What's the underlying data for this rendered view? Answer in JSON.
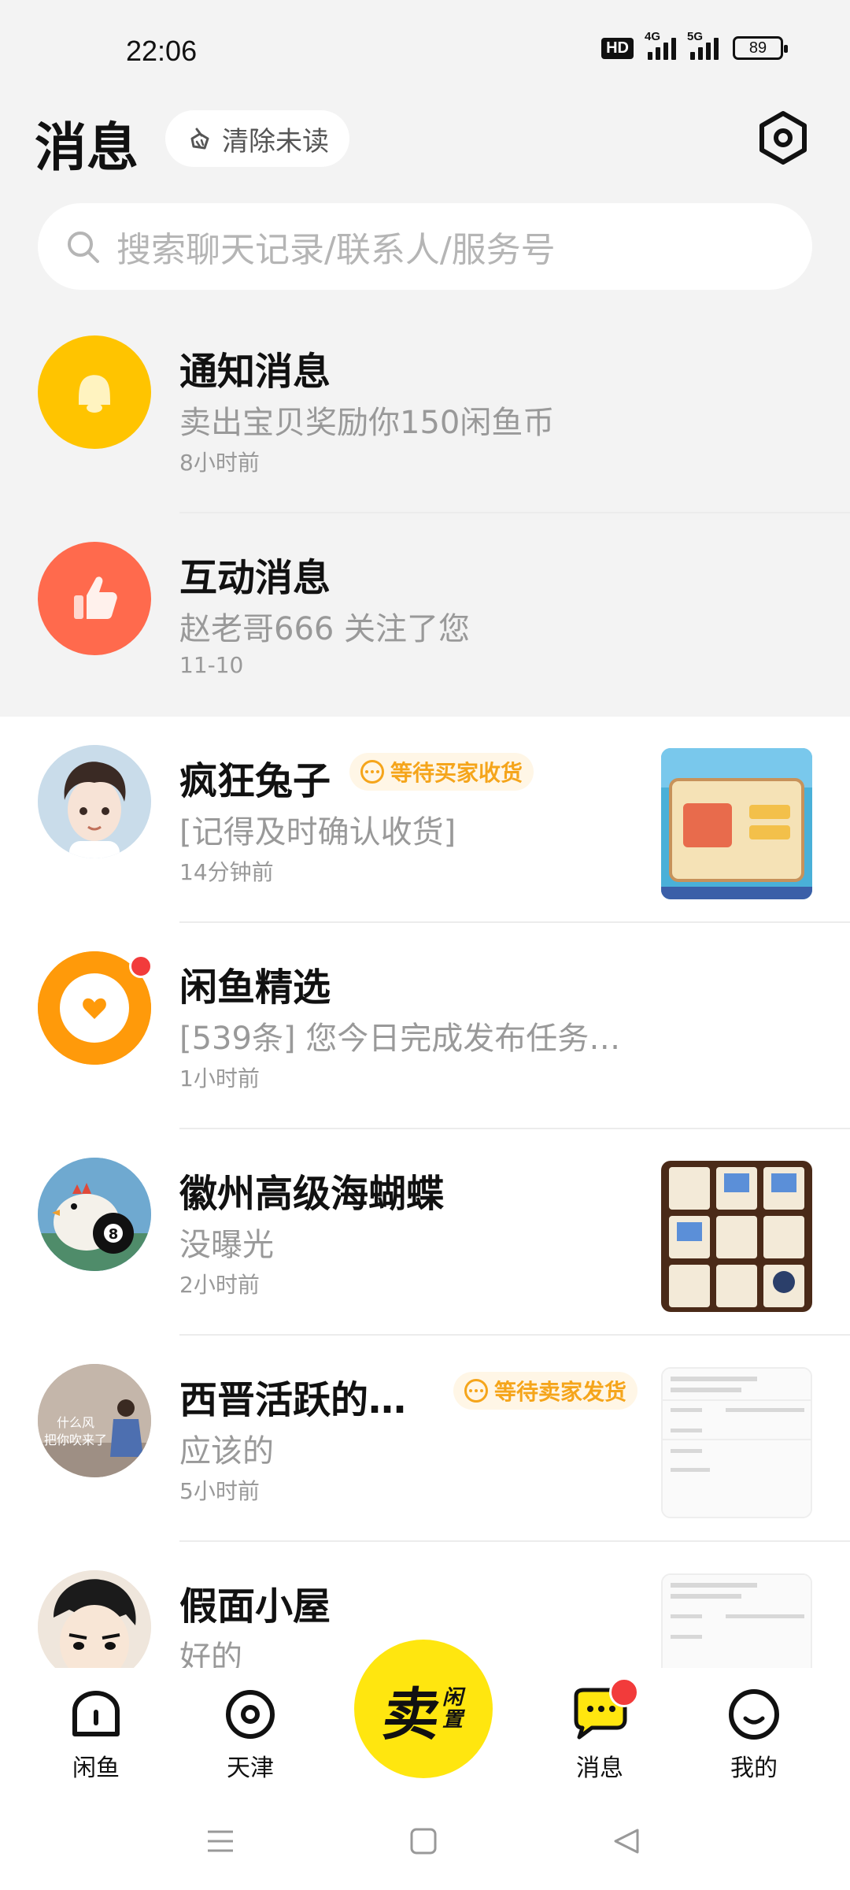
{
  "status": {
    "time": "22:06",
    "hd": "HD",
    "net1": "4G",
    "net2": "5G",
    "battery": "89"
  },
  "header": {
    "title": "消息",
    "clear_label": "清除未读"
  },
  "search": {
    "placeholder": "搜索聊天记录/联系人/服务号"
  },
  "system_items": [
    {
      "name": "通知消息",
      "preview": "卖出宝贝奖励你150闲鱼币",
      "time": "8小时前",
      "icon": "bell-icon",
      "color": "#ffc400"
    },
    {
      "name": "互动消息",
      "preview": "赵老哥666 关注了您",
      "time": "11-10",
      "icon": "thumbs-up-icon",
      "color": "#ff6a4d"
    }
  ],
  "conversations": [
    {
      "name": "疯狂兔子",
      "badge": "等待买家收货",
      "preview": "[记得及时确认收货]",
      "time": "14分钟前"
    },
    {
      "name": "闲鱼精选",
      "preview": "[539条] 您今日完成发布任务…",
      "time": "1小时前",
      "unread": true
    },
    {
      "name": "徽州高级海蝴蝶",
      "preview": "没曝光",
      "time": "2小时前"
    },
    {
      "name": "西晋活跃的…",
      "badge": "等待卖家发货",
      "preview": "应该的",
      "time": "5小时前",
      "avatar_text_1": "什么风",
      "avatar_text_2": "把你吹来了"
    },
    {
      "name": "假面小屋",
      "preview": "好的",
      "time": ""
    }
  ],
  "nav": {
    "home": "闲鱼",
    "city": "天津",
    "sell_big": "卖",
    "sell_small_1": "闲",
    "sell_small_2": "置",
    "messages": "消息",
    "me": "我的"
  },
  "colors": {
    "accent": "#ffe60f",
    "badge": "#f5a51b",
    "unread": "#f23b3b"
  }
}
